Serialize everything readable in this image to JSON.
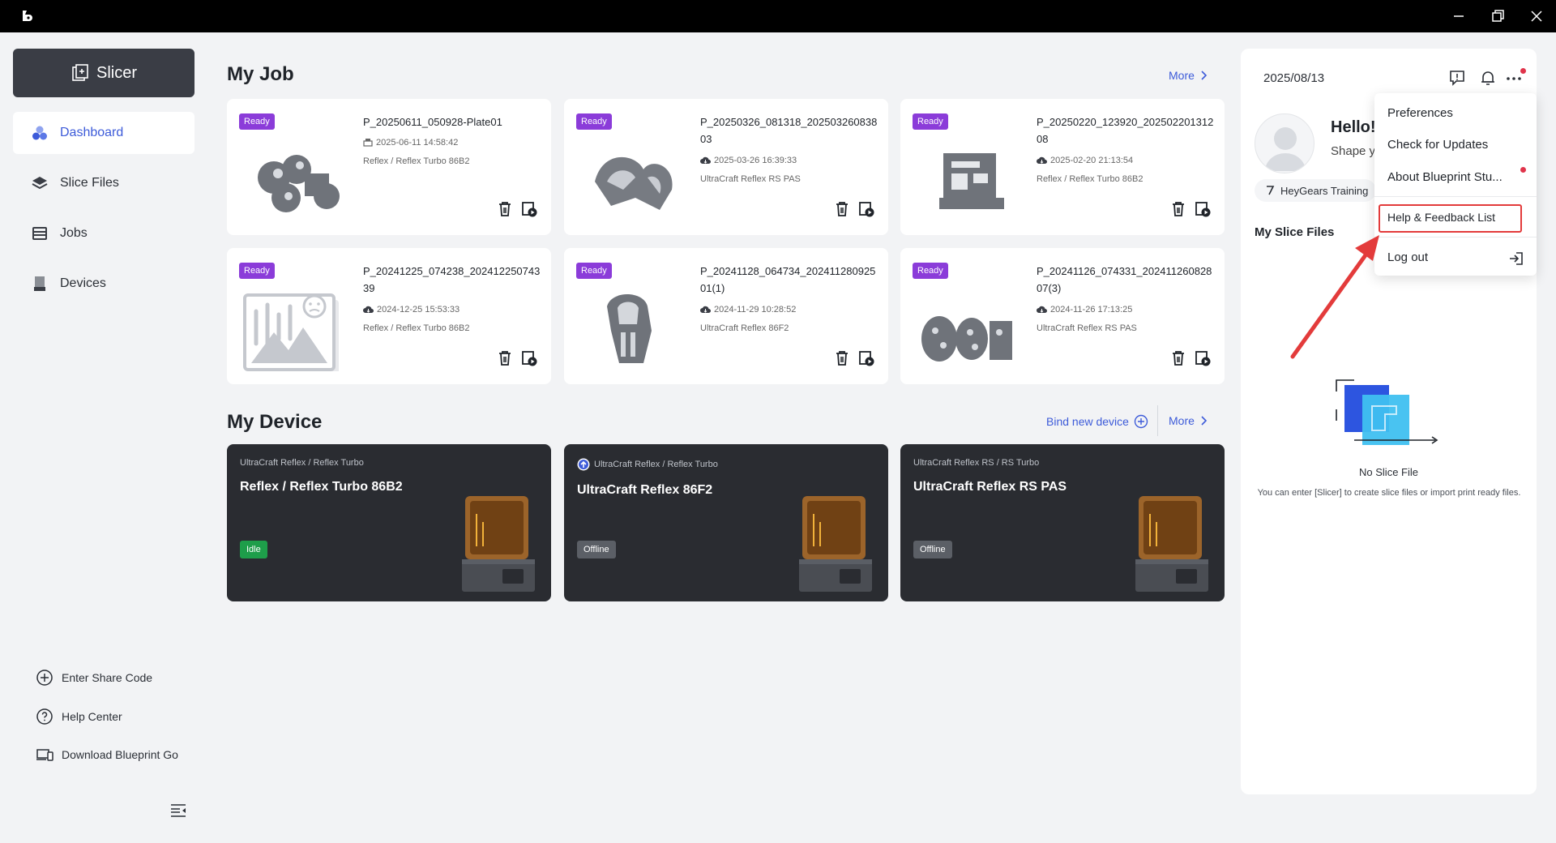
{
  "sidebar": {
    "slicer_label": "Slicer",
    "nav": [
      {
        "label": "Dashboard",
        "icon": "dashboard-icon",
        "active": true
      },
      {
        "label": "Slice Files",
        "icon": "layers-icon",
        "active": false
      },
      {
        "label": "Jobs",
        "icon": "jobs-icon",
        "active": false
      },
      {
        "label": "Devices",
        "icon": "printer-icon",
        "active": false
      }
    ],
    "bottom_links": [
      "Enter Share Code",
      "Help Center",
      "Download Blueprint Go"
    ]
  },
  "my_job": {
    "title": "My Job",
    "more_label": "More",
    "jobs": [
      {
        "status": "Ready",
        "name": "P_20250611_050928-Plate01",
        "date": "2025-06-11 14:58:42",
        "device": "Reflex / Reflex Turbo 86B2"
      },
      {
        "status": "Ready",
        "name": "P_20250326_081318_20250326083803",
        "date": "2025-03-26 16:39:33",
        "device": "UltraCraft Reflex RS PAS"
      },
      {
        "status": "Ready",
        "name": "P_20250220_123920_20250220131208",
        "date": "2025-02-20 21:13:54",
        "device": "Reflex / Reflex Turbo 86B2"
      },
      {
        "status": "Ready",
        "name": "P_20241225_074238_20241225074339",
        "date": "2024-12-25 15:53:33",
        "device": "Reflex / Reflex Turbo 86B2"
      },
      {
        "status": "Ready",
        "name": "P_20241128_064734_20241128092501(1)",
        "date": "2024-11-29 10:28:52",
        "device": "UltraCraft Reflex 86F2"
      },
      {
        "status": "Ready",
        "name": "P_20241126_074331_20241126082807(3)",
        "date": "2024-11-26 17:13:25",
        "device": "UltraCraft Reflex RS PAS"
      }
    ]
  },
  "my_device": {
    "title": "My Device",
    "bind_label": "Bind new device",
    "more_label": "More",
    "devices": [
      {
        "model": "UltraCraft Reflex / Reflex Turbo",
        "name": "Reflex / Reflex Turbo 86B2",
        "status": "Idle",
        "status_color": "#1e9e4a"
      },
      {
        "model": "UltraCraft Reflex / Reflex Turbo",
        "name": "UltraCraft Reflex 86F2",
        "status": "Offline",
        "status_color": "#5b5f66"
      },
      {
        "model": "UltraCraft Reflex RS / RS Turbo",
        "name": "UltraCraft Reflex RS PAS",
        "status": "Offline",
        "status_color": "#5b5f66"
      }
    ]
  },
  "right_panel": {
    "date": "2025/08/13",
    "hello": "Hello!",
    "shape": "Shape y",
    "training_label": "HeyGears Training",
    "my_slice_files": "My Slice Files",
    "empty_title": "No Slice File",
    "empty_desc": "You can enter [Slicer] to create slice files or import print ready files."
  },
  "menu": {
    "items": [
      "Preferences",
      "Check for Updates",
      "About Blueprint Stu...",
      "Help & Feedback List",
      "Log out"
    ]
  },
  "colors": {
    "accent": "#3d5bd9",
    "ready_badge": "#8b3cd9",
    "highlight": "#e33b3b"
  }
}
